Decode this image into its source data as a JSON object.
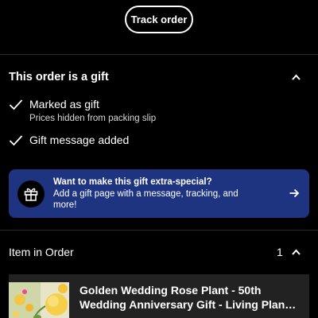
{
  "header": {
    "track_order_label": "Track order"
  },
  "gift_section": {
    "title": "This order is a gift",
    "items": [
      {
        "label": "Marked as gift",
        "sub": "Prices hidden from packing slip"
      },
      {
        "label": "Gift message added",
        "sub": ""
      }
    ]
  },
  "promo": {
    "title": "Want to make this gift extra-special?",
    "body": "Add a gift page with a message, tracking, and more!",
    "icon": "gift-icon",
    "color": "#1e3480"
  },
  "items_section": {
    "title": "Item in Order",
    "count": "1"
  },
  "product": {
    "name": "Golden Wedding Rose Plant - 50th Wedding Anniversary Gift - Living Plan…"
  }
}
